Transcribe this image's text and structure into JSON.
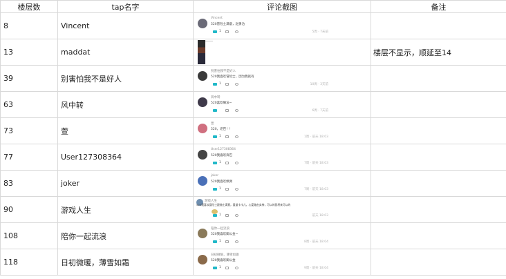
{
  "headers": {
    "floor": "楼层数",
    "name": "tap名字",
    "screenshot": "评论截图",
    "note": "备注"
  },
  "rows": [
    {
      "floor": "8",
      "name": "Vincent",
      "note": "",
      "shot": {
        "user": "Vincent",
        "text": "520冒险士满意，赵勇治",
        "likes": "1",
        "time": "5周 · 7天前",
        "avatar_color": "#6b6b78",
        "style": "normal"
      }
    },
    {
      "floor": "13",
      "name": "maddat",
      "note": "楼层不显示，顺延至14",
      "shot": {
        "user": "",
        "text": "",
        "likes": "",
        "time": "",
        "avatar_color": "#2b2b2b",
        "style": "vertical"
      }
    },
    {
      "floor": "39",
      "name": "别害怕我不是好人",
      "note": "",
      "shot": {
        "user": "别害怕我不是好人",
        "text": "520我喜欢冒险士，因为我就有",
        "likes": "1",
        "time": "10周 · 3天前",
        "avatar_color": "#3a3a3a",
        "style": "normal"
      }
    },
    {
      "floor": "63",
      "name": "风中转",
      "note": "",
      "shot": {
        "user": "风中转",
        "text": "520喜欢嘛法~",
        "likes": "",
        "time": "6周 · 7天前",
        "avatar_color": "#3f3a4a",
        "style": "normal"
      }
    },
    {
      "floor": "73",
      "name": "萱",
      "note": "",
      "shot": {
        "user": "萱",
        "text": "520，老巴！！",
        "likes": "1",
        "time": "1周 · 前天 18:03",
        "avatar_color": "#d07080",
        "style": "normal"
      }
    },
    {
      "floor": "77",
      "name": "User127308364",
      "note": "",
      "shot": {
        "user": "User127308364",
        "text": "520我喜欢奔巴",
        "likes": "1",
        "time": "7周 · 前天 18:03",
        "avatar_color": "#444444",
        "style": "normal"
      }
    },
    {
      "floor": "83",
      "name": "joker",
      "note": "",
      "shot": {
        "user": "joker",
        "text": "520我喜欢佩佩",
        "likes": "1",
        "time": "7周 · 前天 18:03",
        "avatar_color": "#4a70b8",
        "style": "normal"
      }
    },
    {
      "floor": "90",
      "name": "游戏人生",
      "note": "",
      "shot": {
        "user": "游戏人生",
        "text": "520我喜欢冒险士跟随士满意，重量卡卡儿，心爱路由卖神，可以的我将来可以的",
        "likes": "1",
        "time": "前天 18:03",
        "avatar_color": "#6f8fb0",
        "style": "wide"
      }
    },
    {
      "floor": "108",
      "name": "陪你一起流浪",
      "note": "",
      "shot": {
        "user": "陪你一起流浪",
        "text": "520我喜欢卿公金~",
        "likes": "1",
        "time": "8周 · 前天 18:04",
        "avatar_color": "#8a7a5a",
        "style": "normal"
      }
    },
    {
      "floor": "118",
      "name": "日初微暖，薄雪如霜",
      "note": "",
      "shot": {
        "user": "日初微暖，薄雪如霜",
        "text": "520我喜欢卿公金",
        "likes": "1",
        "time": "9周 · 前天 18:04",
        "avatar_color": "#8a6a4a",
        "style": "normal"
      }
    }
  ]
}
